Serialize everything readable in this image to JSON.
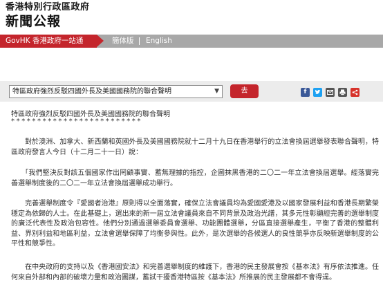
{
  "header": {
    "line1": "香港特別行政區政府",
    "line2": "新聞公報"
  },
  "nav": {
    "govhk": "GovHK 香港政府一站通",
    "simplified": "簡体版",
    "english": "English"
  },
  "toolbar": {
    "select_value": "特區政府強烈反駁四國外長及美國國務院的聯合聲明",
    "go_label": "去",
    "share_icons": [
      "facebook-icon",
      "twitter-icon",
      "email-icon",
      "print-icon",
      "share-icon"
    ],
    "colors": {
      "facebook": "#3b5998",
      "twitter": "#1da1f2",
      "email": "#555555",
      "print": "#555555",
      "share": "#d6322a"
    }
  },
  "article": {
    "title": "特區政府強烈反駁四國外長及美國國務院的聯合聲明",
    "stars": "*************************",
    "paragraphs": [
      "　　對於澳洲、加拿大、新西蘭和英國外長及美國國務院就十二月十九日在香港舉行的立法會換屆選舉發表聯合聲明，特區政府發言人今日（十二月二十一日）說：",
      "　　「我們堅決反對該五個國家作出罔顧事實、蓄無理據的指控，企圖抹黑香港的二〇二一年立法會換屆選舉。經落實完善選舉制度後的二〇二一年立法會換屆選舉成功舉行。",
      "　　完善選舉制度令『愛國者治港』原則得以全面落實，確保立法會議員均為愛國愛港及以國家發展利益和香港長期繁榮穩定為依歸的人士。在此基礎上，選出來的新一屆立法會議員來自不同背景及政治光譜，其多元性彰顯經完善的選舉制度的廣泛代表性及政治包容性。他們分別通過選舉委員會選舉、功能團體選舉，分區直接選舉產生，平衡了香港的整體利益、界別利益和地區利益，立法會選舉保障了均衡參與性。此外，是次選舉的各候選人的良性競爭亦反映新選舉制度的公平性和競爭性。",
      "　　在中央政府的支持以及《香港國安法》和完善選舉制度的維護下，香港的民主發展會按《基本法》有序依法推進。任何來自外部和內部的破壞力量和政治圖謀，蓄試干擾香港特區按《基本法》所推展的民主發展都不會得逞。"
    ]
  }
}
